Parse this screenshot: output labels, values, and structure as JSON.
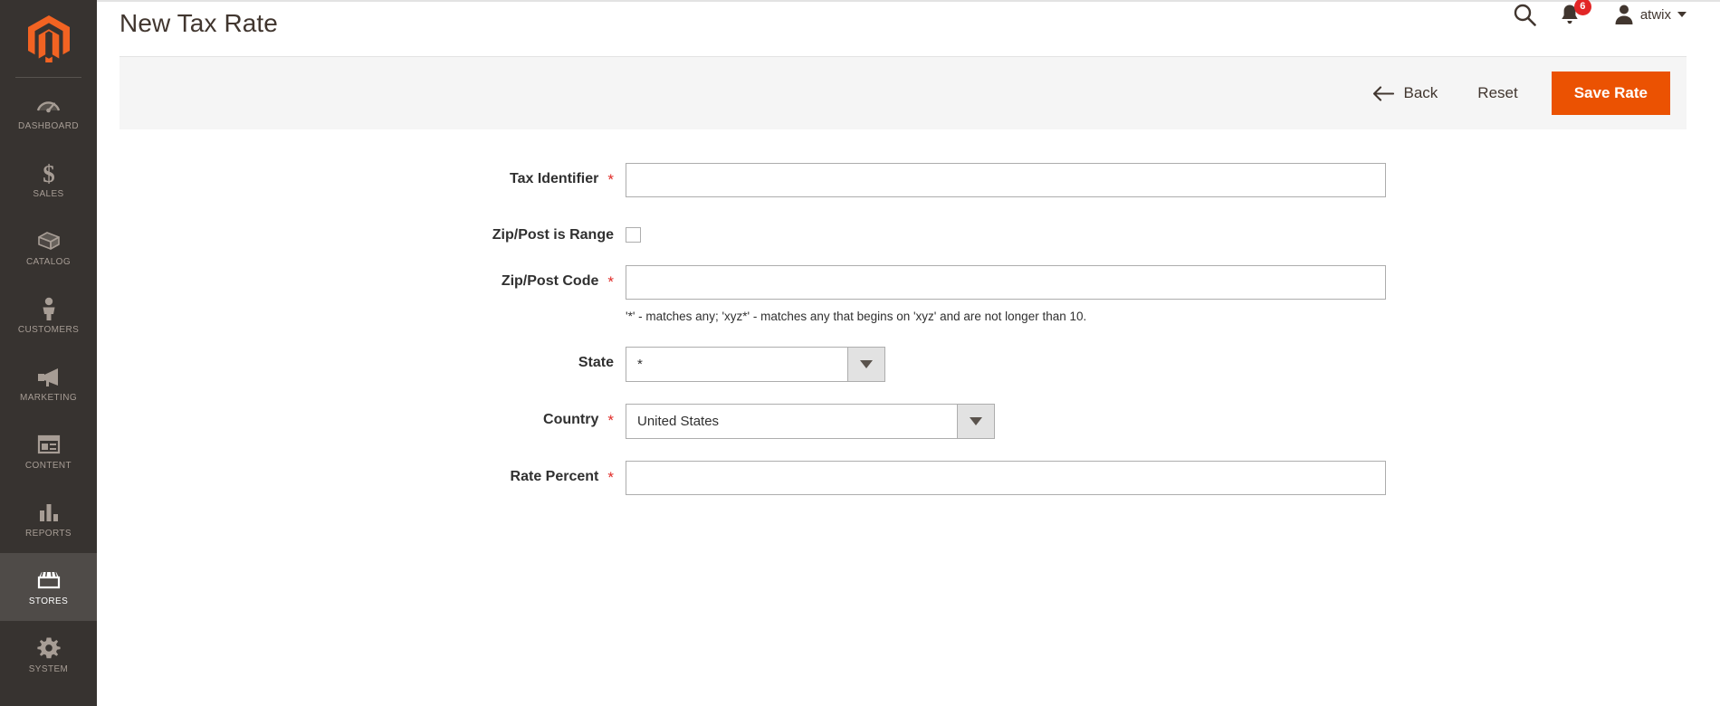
{
  "brand": {
    "logo_icon": "magento-logo-icon",
    "accent_color": "#eb5202",
    "sidebar_color": "#373330"
  },
  "sidebar": {
    "items": [
      {
        "label": "Dashboard",
        "icon": "dashboard-gauge-icon",
        "active": false
      },
      {
        "label": "Sales",
        "icon": "dollar-sign-icon",
        "active": false
      },
      {
        "label": "Catalog",
        "icon": "box-package-icon",
        "active": false
      },
      {
        "label": "Customers",
        "icon": "person-icon",
        "active": false
      },
      {
        "label": "Marketing",
        "icon": "megaphone-icon",
        "active": false
      },
      {
        "label": "Content",
        "icon": "layout-window-icon",
        "active": false
      },
      {
        "label": "Reports",
        "icon": "bar-chart-icon",
        "active": false
      },
      {
        "label": "Stores",
        "icon": "storefront-icon",
        "active": true
      },
      {
        "label": "System",
        "icon": "gear-icon",
        "active": false
      }
    ]
  },
  "header": {
    "title": "New Tax Rate",
    "search_icon": "search-icon",
    "bell_icon": "bell-notification-icon",
    "notification_count": "6",
    "user_icon": "user-avatar-icon",
    "user_name": "atwix",
    "caret_icon": "chevron-down-icon"
  },
  "toolbar": {
    "back_label": "Back",
    "back_icon": "arrow-left-icon",
    "reset_label": "Reset",
    "save_label": "Save Rate"
  },
  "form": {
    "tax_identifier": {
      "label": "Tax Identifier",
      "required": "*",
      "value": "",
      "placeholder": ""
    },
    "zip_is_range": {
      "label": "Zip/Post is Range",
      "checked": false
    },
    "zip_code": {
      "label": "Zip/Post Code",
      "required": "*",
      "value": "",
      "placeholder": "",
      "note": "'*' - matches any; 'xyz*' - matches any that begins on 'xyz' and are not longer than 10."
    },
    "state": {
      "label": "State",
      "required": "",
      "value": "*"
    },
    "country": {
      "label": "Country",
      "required": "*",
      "value": "United States"
    },
    "rate_percent": {
      "label": "Rate Percent",
      "required": "*",
      "value": "",
      "placeholder": ""
    }
  }
}
